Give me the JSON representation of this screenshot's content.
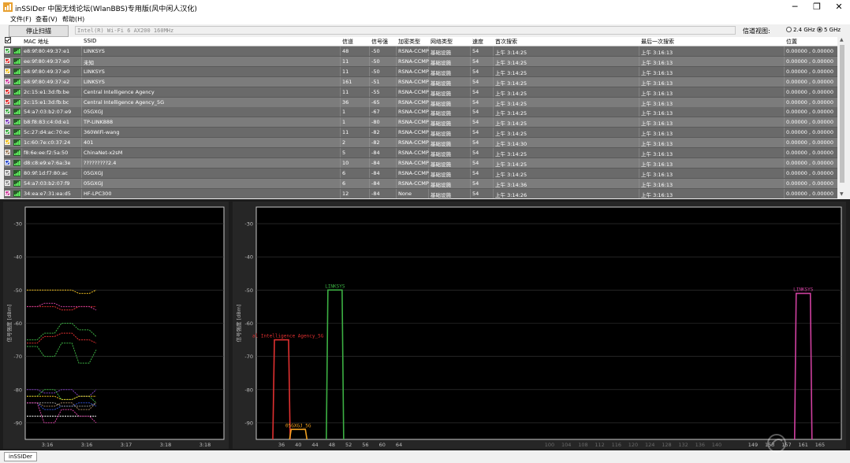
{
  "window": {
    "title": "inSSIDer 中国无线论坛(WlanBBS)专用版(风中闲人汉化)",
    "minimize": "─",
    "maximize": "❐",
    "close": "✕"
  },
  "menu": [
    "文件(F)",
    "查看(V)",
    "帮助(H)"
  ],
  "toolbar": {
    "stop_label": "停止扫描",
    "adapter": "Intel(R) Wi-Fi 6 AX200 160MHz",
    "band_label": "信道视图:",
    "band_24": "2.4 GHz",
    "band_5": "5 GHz",
    "selected_band": "5 GHz"
  },
  "table": {
    "headers": [
      "MAC 地址",
      "SSID",
      "信道",
      "信号强",
      "加密类型",
      "网络类型",
      "速度",
      "首次搜索",
      "最后一次搜索",
      "位置"
    ],
    "rows": [
      {
        "color": "#3cb043",
        "mac": "e8:9f:80:49:37:e1",
        "ssid": "LINKSYS",
        "channel": "48",
        "rssi": "-50",
        "security": "RSNA-CCMP",
        "type": "基础设施",
        "speed": "54",
        "first": "上午 3:14:25",
        "last": "上午 3:16:13",
        "loc": "0.00000 , 0.00000"
      },
      {
        "color": "#e03030",
        "mac": "ee:9f:80:49:37:e0",
        "ssid": "未知",
        "channel": "11",
        "rssi": "-50",
        "security": "RSNA-CCMP",
        "type": "基础设施",
        "speed": "54",
        "first": "上午 3:14:25",
        "last": "上午 3:16:13",
        "loc": "0.00000 , 0.00000"
      },
      {
        "color": "#f0c020",
        "mac": "e8:9f:80:49:37:e0",
        "ssid": "LINKSYS",
        "channel": "11",
        "rssi": "-50",
        "security": "RSNA-CCMP",
        "type": "基础设施",
        "speed": "54",
        "first": "上午 3:14:25",
        "last": "上午 3:16:13",
        "loc": "0.00000 , 0.00000"
      },
      {
        "color": "#d040a0",
        "mac": "e8:9f:80:49:37:e2",
        "ssid": "LINKSYS",
        "channel": "161",
        "rssi": "-51",
        "security": "RSNA-CCMP",
        "type": "基础设施",
        "speed": "54",
        "first": "上午 3:14:25",
        "last": "上午 3:16:13",
        "loc": "0.00000 , 0.00000"
      },
      {
        "color": "#e03030",
        "mac": "2c:15:e1:3d:fb:be",
        "ssid": "Central Intelligence Agency",
        "channel": "11",
        "rssi": "-55",
        "security": "RSNA-CCMP",
        "type": "基础设施",
        "speed": "54",
        "first": "上午 3:14:25",
        "last": "上午 3:16:13",
        "loc": "0.00000 , 0.00000"
      },
      {
        "color": "#e03030",
        "mac": "2c:15:e1:3d:fb:bc",
        "ssid": "Central Intelligence Agency_5G",
        "channel": "36",
        "rssi": "-65",
        "security": "RSNA-CCMP",
        "type": "基础设施",
        "speed": "54",
        "first": "上午 3:14:25",
        "last": "上午 3:16:13",
        "loc": "0.00000 , 0.00000"
      },
      {
        "color": "#3cb043",
        "mac": "54:a7:03:b2:07:e9",
        "ssid": "05GXGJ",
        "channel": "1",
        "rssi": "-67",
        "security": "RSNA-CCMP",
        "type": "基础设施",
        "speed": "54",
        "first": "上午 3:14:25",
        "last": "上午 3:16:13",
        "loc": "0.00000 , 0.00000"
      },
      {
        "color": "#8040c0",
        "mac": "b8:f8:83:c4:0d:e1",
        "ssid": "TP-LINK888",
        "channel": "1",
        "rssi": "-80",
        "security": "RSNA-CCMP",
        "type": "基础设施",
        "speed": "54",
        "first": "上午 3:14:25",
        "last": "上午 3:16:13",
        "loc": "0.00000 , 0.00000"
      },
      {
        "color": "#3cb043",
        "mac": "5c:27:d4:ac:70:ec",
        "ssid": "360WiFi-wang",
        "channel": "11",
        "rssi": "-82",
        "security": "RSNA-CCMP",
        "type": "基础设施",
        "speed": "54",
        "first": "上午 3:14:25",
        "last": "上午 3:16:13",
        "loc": "0.00000 , 0.00000"
      },
      {
        "color": "#f0c020",
        "mac": "1c:60:7e:c0:37:24",
        "ssid": "401",
        "channel": "2",
        "rssi": "-82",
        "security": "RSNA-CCMP",
        "type": "基础设施",
        "speed": "54",
        "first": "上午 3:14:30",
        "last": "上午 3:16:13",
        "loc": "0.00000 , 0.00000"
      },
      {
        "color": "#a08060",
        "mac": "f8:6e:ee:f2:5a:50",
        "ssid": "ChinaNet-x2sM",
        "channel": "5",
        "rssi": "-84",
        "security": "RSNA-CCMP",
        "type": "基础设施",
        "speed": "54",
        "first": "上午 3:14:25",
        "last": "上午 3:16:13",
        "loc": "0.00000 , 0.00000"
      },
      {
        "color": "#3050d0",
        "mac": "d8:c8:e9:e7:6a:3e",
        "ssid": "?????????2.4",
        "channel": "10",
        "rssi": "-84",
        "security": "RSNA-CCMP",
        "type": "基础设施",
        "speed": "54",
        "first": "上午 3:14:25",
        "last": "上午 3:16:13",
        "loc": "0.00000 , 0.00000"
      },
      {
        "color": "#909090",
        "mac": "80:9f:1d:f7:80:ac",
        "ssid": "05GXGJ",
        "channel": "6",
        "rssi": "-84",
        "security": "RSNA-CCMP",
        "type": "基础设施",
        "speed": "54",
        "first": "上午 3:14:25",
        "last": "上午 3:16:13",
        "loc": "0.00000 , 0.00000"
      },
      {
        "color": "#909090",
        "mac": "54:a7:03:b2:07:f9",
        "ssid": "05GXGJ",
        "channel": "6",
        "rssi": "-84",
        "security": "RSNA-CCMP",
        "type": "基础设施",
        "speed": "54",
        "first": "上午 3:14:36",
        "last": "上午 3:16:13",
        "loc": "0.00000 , 0.00000"
      },
      {
        "color": "#d040a0",
        "mac": "34:ea:e7:31:ea:d5",
        "ssid": "HF-LPC300",
        "channel": "12",
        "rssi": "-84",
        "security": "None",
        "type": "基础设施",
        "speed": "54",
        "first": "上午 3:14:26",
        "last": "上午 3:16:13",
        "loc": "0.00000 , 0.00000"
      }
    ]
  },
  "time_chart": {
    "ylabel": "信号强度 [dBm]",
    "y_ticks": [
      "-30",
      "-40",
      "-50",
      "-60",
      "-70",
      "-80",
      "-90"
    ],
    "x_ticks": [
      "3:16",
      "3:16",
      "3:17",
      "3:18",
      "3:18"
    ]
  },
  "channel_chart": {
    "ylabel": "信号强度 [dBm]",
    "y_ticks": [
      "-30",
      "-40",
      "-50",
      "-60",
      "-70",
      "-80",
      "-90"
    ],
    "x_ticks": [
      "36",
      "40",
      "44",
      "48",
      "52",
      "56",
      "60",
      "64",
      "100",
      "104",
      "108",
      "112",
      "116",
      "120",
      "124",
      "128",
      "132",
      "136",
      "140",
      "149",
      "153",
      "157",
      "161",
      "165"
    ],
    "labels": {
      "cia": "al Intelligence Agency_5G",
      "linksys48": "LINKSYS",
      "gxgj": "05GXGJ_5G",
      "linksys161": "LINKSYS"
    }
  },
  "statusbar": {
    "tab": "inSSIDer"
  },
  "chart_data": [
    {
      "type": "line",
      "ylabel": "信号强度 [dBm]",
      "x": [
        "3:16",
        "3:16",
        "3:17",
        "3:18",
        "3:18"
      ],
      "ylim": [
        -95,
        -25
      ],
      "series": [
        {
          "color": "#f0c020",
          "values": [
            -50,
            -50,
            -50,
            -51,
            -50
          ]
        },
        {
          "color": "#e03030",
          "values": [
            -55,
            -55,
            -56,
            -55,
            -55
          ]
        },
        {
          "color": "#d040a0",
          "values": [
            -55,
            -54,
            -55,
            -55,
            -56
          ]
        },
        {
          "color": "#3cb043",
          "values": [
            -65,
            -63,
            -60,
            -62,
            -64
          ]
        },
        {
          "color": "#e03030",
          "values": [
            -66,
            -64,
            -63,
            -65,
            -66
          ]
        },
        {
          "color": "#3cb043",
          "values": [
            -67,
            -70,
            -66,
            -72,
            -68
          ]
        },
        {
          "color": "#8040c0",
          "values": [
            -80,
            -81,
            -80,
            -82,
            -80
          ]
        },
        {
          "color": "#3cb043",
          "values": [
            -82,
            -80,
            -83,
            -82,
            -84
          ]
        },
        {
          "color": "#f0c020",
          "values": [
            -82,
            -82,
            -83,
            -82,
            -82
          ]
        },
        {
          "color": "#a08060",
          "values": [
            -84,
            -85,
            -84,
            -86,
            -84
          ]
        },
        {
          "color": "#3050d0",
          "values": [
            -84,
            -86,
            -85,
            -84,
            -85
          ]
        },
        {
          "color": "#909090",
          "values": [
            -84,
            -84,
            -85,
            -85,
            -84
          ]
        },
        {
          "color": "#ffffff",
          "values": [
            -88,
            -88,
            -88,
            -88,
            -88
          ]
        },
        {
          "color": "#d040a0",
          "values": [
            -84,
            -90,
            -86,
            -88,
            -90
          ]
        }
      ]
    },
    {
      "type": "bar",
      "ylabel": "信号强度 [dBm]",
      "ylim": [
        -95,
        -25
      ],
      "series": [
        {
          "ssid": "Central Intelligence Agency_5G",
          "channel": 36,
          "rssi": -65,
          "color": "#e03030"
        },
        {
          "ssid": "05GXGJ_5G",
          "channel": 40,
          "rssi": -92,
          "color": "#f0a020"
        },
        {
          "ssid": "LINKSYS",
          "channel": 48,
          "rssi": -50,
          "color": "#3cb043"
        },
        {
          "ssid": "LINKSYS",
          "channel": 161,
          "rssi": -51,
          "color": "#d040a0"
        }
      ]
    }
  ]
}
